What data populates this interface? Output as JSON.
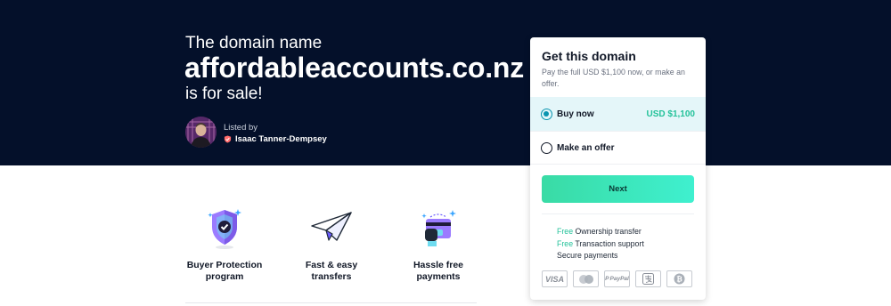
{
  "hero": {
    "lead": "The domain name",
    "domain": "affordableaccounts.co.nz",
    "for_sale": "is for sale!",
    "listed_by_label": "Listed by",
    "lister_name": "Isaac Tanner-Dempsey"
  },
  "features": [
    {
      "label_line1": "Buyer Protection",
      "label_line2": "program",
      "icon": "shield-check-icon"
    },
    {
      "label_line1": "Fast & easy",
      "label_line2": "transfers",
      "icon": "paper-plane-icon"
    },
    {
      "label_line1": "Hassle free",
      "label_line2": "payments",
      "icon": "card-hand-icon"
    }
  ],
  "card": {
    "title": "Get this domain",
    "subtitle": "Pay the full USD $1,100 now, or make an offer.",
    "options": [
      {
        "label": "Buy now",
        "price": "USD $1,100",
        "selected": true
      },
      {
        "label": "Make an offer",
        "selected": false
      }
    ],
    "next_label": "Next",
    "perks": [
      {
        "free": "Free",
        "text": " Ownership transfer"
      },
      {
        "free": "Free",
        "text": " Transaction support"
      },
      {
        "free": "",
        "text": "Secure payments"
      }
    ],
    "payment_methods": [
      "VISA",
      "mastercard-icon",
      "PayPal",
      "alipay-icon",
      "bitcoin-icon"
    ]
  },
  "colors": {
    "hero_bg": "#04102a",
    "accent_green": "#24c29a",
    "selected_row": "#e4f6f9",
    "radio_accent": "#0a95b0"
  }
}
